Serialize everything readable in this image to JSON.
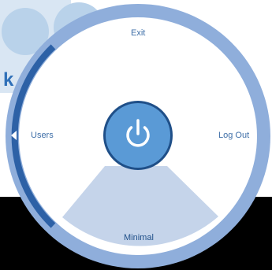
{
  "background": {
    "letter": "k"
  },
  "menu": {
    "center_button": {
      "icon": "power-icon"
    },
    "items": [
      {
        "id": "exit",
        "label": "Exit"
      },
      {
        "id": "users",
        "label": "Users",
        "icon": "caret-left-icon"
      },
      {
        "id": "logout",
        "label": "Log Out"
      },
      {
        "id": "minimal",
        "label": "Minimal"
      }
    ]
  },
  "colors": {
    "ring": "#8faedb",
    "disc": "#ffffff",
    "left_arc": "#2d61a6",
    "center_fill": "#5a9ad6",
    "center_ring": "#1f4f88",
    "minimal_sector": "#c5d4ea"
  }
}
